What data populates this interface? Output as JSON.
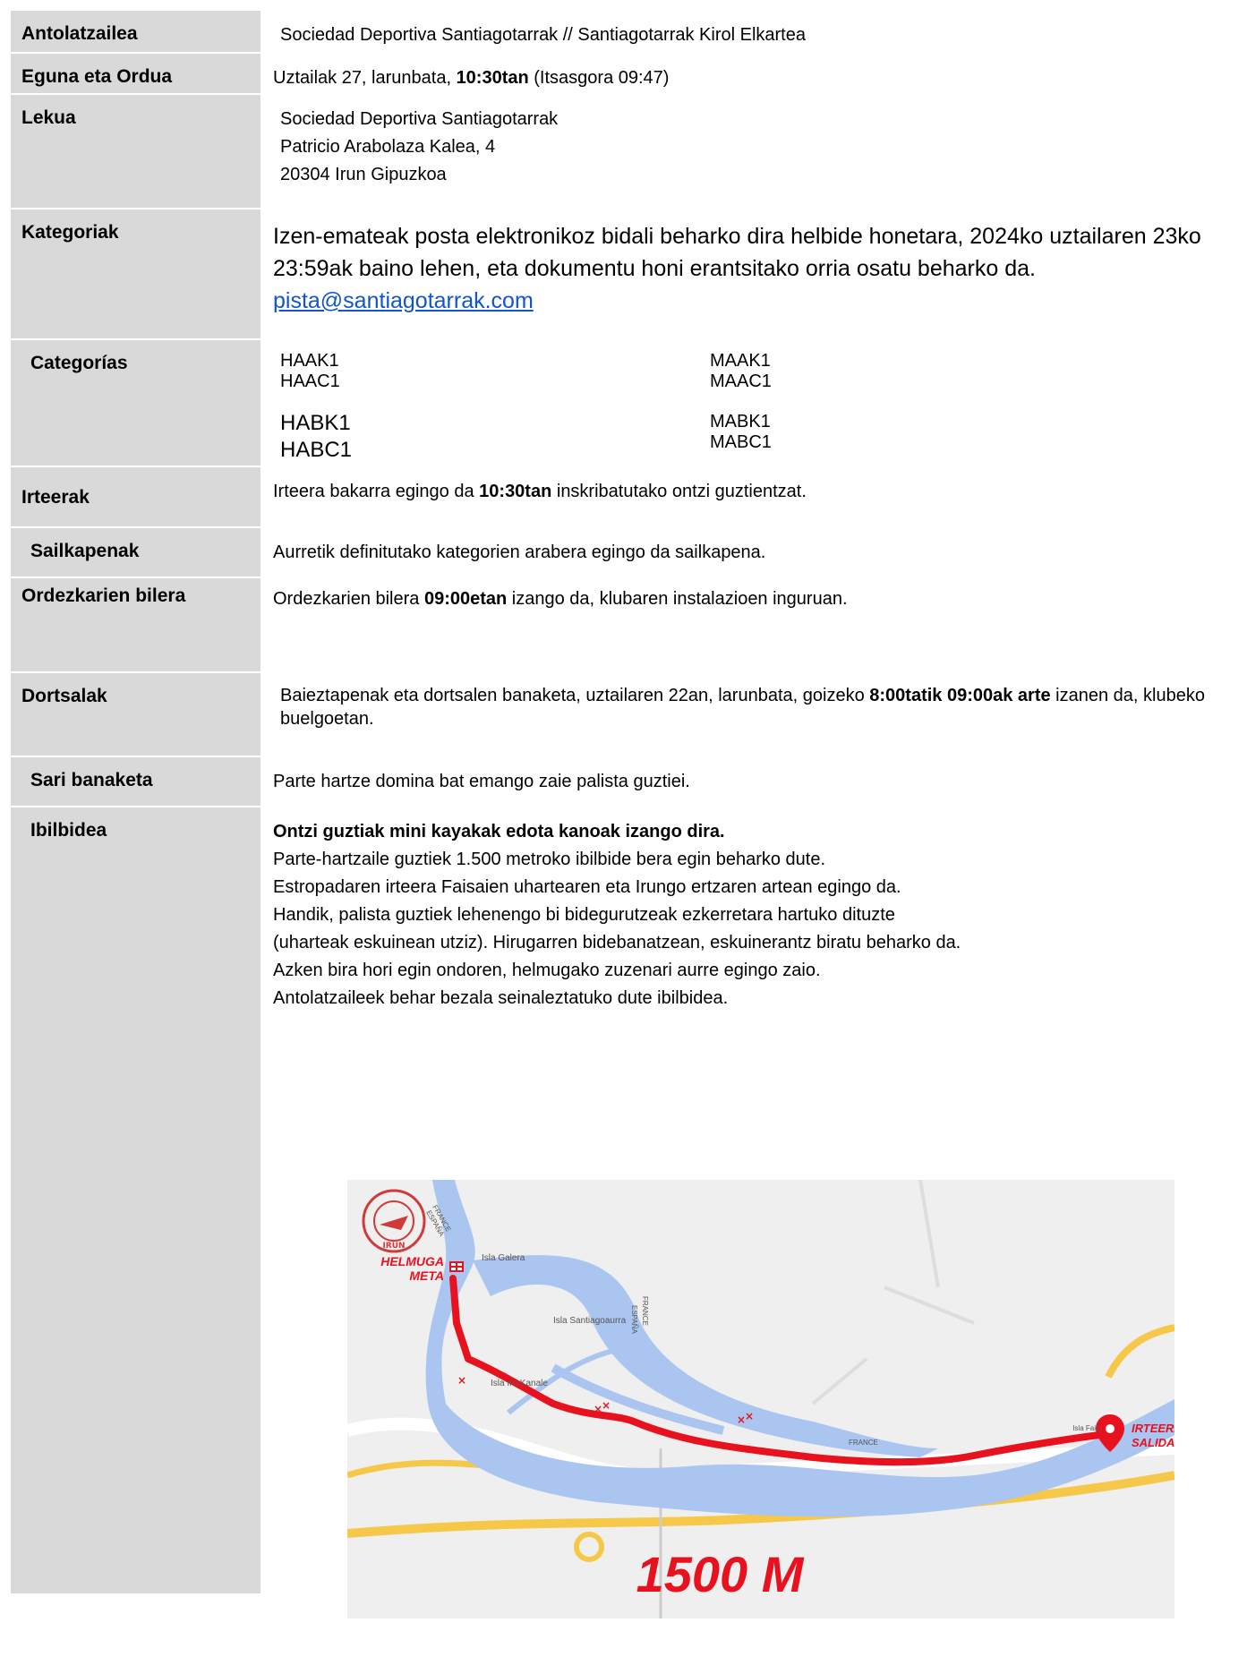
{
  "rows": {
    "antolatzailea": {
      "label": "Antolatzailea",
      "value": "Sociedad Deportiva Santiagotarrak // Santiagotarrak Kirol Elkartea"
    },
    "eguna": {
      "label": "Eguna eta Ordua",
      "pre": "Uztailak 27, larunbata, ",
      "bold": "10:30tan",
      "post": " (Itsasgora 09:47)"
    },
    "lekua": {
      "label": "Lekua",
      "lines": [
        "Sociedad Deportiva Santiagotarrak",
        "Patricio Arabolaza Kalea, 4",
        "20304 Irun Gipuzkoa"
      ]
    },
    "kategoriak": {
      "label": "Kategoriak",
      "text": "Izen-emateak posta elektronikoz bidali beharko dira helbide honetara, 2024ko uztailaren 23ko 23:59ak baino lehen, eta dokumentu honi erantsitako orria osatu beharko da.",
      "email": "pista@santiagotarrak.com"
    },
    "categorias": {
      "label": "Categorías",
      "col1a": [
        "HAAK1",
        "HAAC1"
      ],
      "col2a": [
        "MAAK1",
        "MAAC1"
      ],
      "col1b": [
        "HABK1",
        "HABC1"
      ],
      "col2b": [
        "MABK1",
        "MABC1"
      ]
    },
    "irteerak": {
      "label": "Irteerak",
      "pre": "Irteera bakarra egingo da ",
      "bold": "10:30tan",
      "post": " inskribatutako ontzi guztientzat."
    },
    "sailkapenak": {
      "label": "Sailkapenak",
      "value": "Aurretik definitutako kategorien arabera egingo da sailkapena."
    },
    "bilera": {
      "label": "Ordezkarien bilera",
      "pre": "Ordezkarien bilera ",
      "bold": "09:00etan",
      "post": " izango da, klubaren instalazioen inguruan."
    },
    "dortsalak": {
      "label": "Dortsalak",
      "pre": "Baieztapenak eta dortsalen banaketa, uztailaren 22an, larunbata, goizeko ",
      "bold": "8:00tatik 09:00ak arte",
      "post": " izanen da, klubeko buelgoetan."
    },
    "sari": {
      "label": "Sari banaketa",
      "value": "Parte hartze domina bat emango zaie palista guztiei."
    },
    "ibilbidea": {
      "label": "Ibilbidea",
      "bold": "Ontzi guztiak mini kayakak edota kanoak izango dira.",
      "lines": [
        "Parte-hartzaile guztiek 1.500 metroko ibilbide bera egin beharko dute.",
        "Estropadaren irteera Faisaien uhartearen eta Irungo ertzaren artean egingo da.",
        "Handik, palista guztiek lehenengo bi bidegurutzeak ezkerretara hartuko dituzte",
        "(uharteak eskuinean utziz). Hirugarren bidebanatzean, eskuinerantz biratu beharko da.",
        "Azken bira hori egin ondoren, helmugako zuzenari aurre egingo zaio.",
        "Antolatzaileek behar bezala seinaleztatuko dute ibilbidea."
      ]
    }
  },
  "map": {
    "finish_label_1": "HELMUGA",
    "finish_label_2": "META",
    "start_label_1": "IRTEERA",
    "start_label_2": "SALIDA",
    "distance": "1500 M",
    "place_isla_galera": "Isla Galera",
    "place_isla_santiago": "Isla Santiagoaurra",
    "place_isla_iru": "Isla Iru Kanale",
    "place_france_1": "FRANCE",
    "place_espana_1": "ESPAÑA",
    "place_france_2": "FRANCE",
    "place_espana_2": "ESPAÑA",
    "place_france_3": "FRANCE",
    "place_isla_fais": "Isla Fais",
    "logo_text": "IRUN",
    "colors": {
      "water": "#a9c5f0",
      "route": "#e8121f",
      "land": "#eeeeee",
      "road": "#f6c84a"
    }
  }
}
